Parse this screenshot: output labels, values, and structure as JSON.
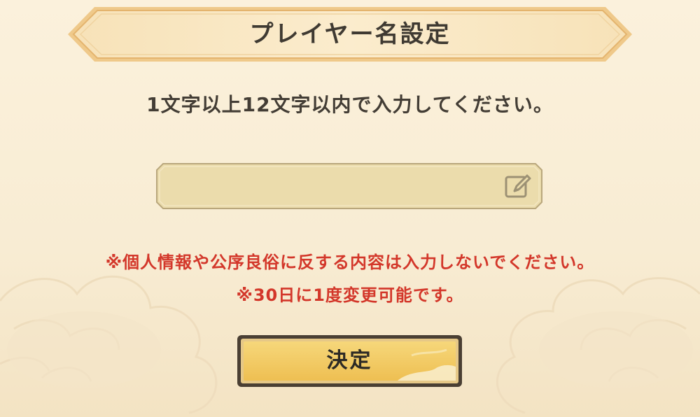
{
  "dialog": {
    "title": "プレイヤー名設定",
    "instruction": "1文字以上12文字以内で入力してください。",
    "name_input": {
      "value": "",
      "placeholder": ""
    },
    "notices": [
      "※個人情報や公序良俗に反する内容は入力しないでください。",
      "※30日に1度変更可能です。"
    ],
    "confirm_label": "決定"
  },
  "colors": {
    "background": "#fbf1dc",
    "title_text": "#3f3a32",
    "notice_text": "#d3372a",
    "button_fill": "#f0c95e",
    "button_border": "#4a3f33"
  },
  "icons": {
    "edit": "pencil-edit-icon"
  }
}
